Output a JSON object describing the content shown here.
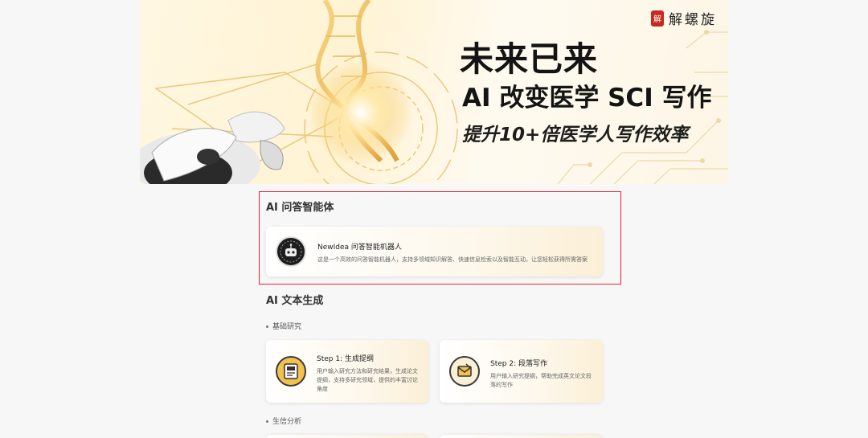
{
  "banner": {
    "logo_seal": "解",
    "logo_text": "解螺旋",
    "title": "未来已来",
    "subtitle": "AI 改变医学 SCI 写作",
    "tagline": "提升10+倍医学人写作效率"
  },
  "qa_section": {
    "title": "AI 问答智能体",
    "card": {
      "icon": "robot-icon",
      "title": "NewIdea 问答智能机器人",
      "description": "这是一个高效的问答智能机器人，支持多领域知识解答、快速信息检索以及智能互动，让您轻松获得所需答案"
    }
  },
  "text_section": {
    "title": "AI 文本生成",
    "groups": [
      {
        "label": "基础研究",
        "cards": [
          {
            "icon": "outline-document-icon",
            "title": "Step 1: 生成提纲",
            "description": "用户输入研究方法和研究结果，生成论文提纲，支持多研究领域，提供的丰富讨论角度"
          },
          {
            "icon": "envelope-writing-icon",
            "title": "Step 2: 段落写作",
            "description": "用户输入研究提纲，帮助完成英文论文段落的写作"
          }
        ]
      },
      {
        "label": "生信分析"
      }
    ]
  },
  "colors": {
    "highlight_border": "#e0242c",
    "card_gradient_end": "#fbefd6",
    "page_background": "#f7f7f7"
  }
}
